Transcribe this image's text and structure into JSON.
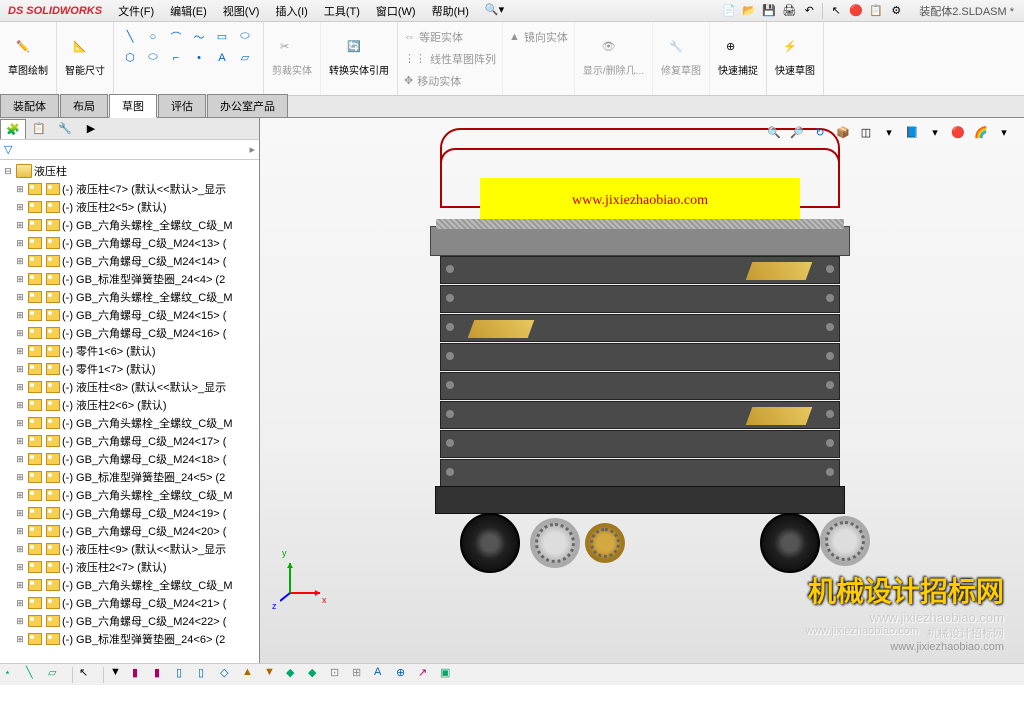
{
  "app": {
    "name": "SOLIDWORKS",
    "logo_prefix": "DS"
  },
  "document_title": "装配体2.SLDASM *",
  "menu": {
    "file": "文件(F)",
    "edit": "编辑(E)",
    "view": "视图(V)",
    "insert": "插入(I)",
    "tools": "工具(T)",
    "window": "窗口(W)",
    "help": "帮助(H)"
  },
  "ribbon": {
    "sketch": "草图绘制",
    "smart_dim": "智能尺寸",
    "trim": "剪裁实体",
    "convert": "转换实体引用",
    "offset": "等距实体",
    "mirror": "镜向实体",
    "linear_pattern": "线性草图阵列",
    "move": "移动实体",
    "display_delete": "显示/删除几...",
    "repair": "修复草图",
    "quick_snap": "快速捕捉",
    "rapid_sketch": "快速草图"
  },
  "tabs": {
    "assembly": "装配体",
    "layout": "布局",
    "sketch": "草图",
    "evaluate": "评估",
    "office": "办公室产品"
  },
  "tree": {
    "root": "液压柱",
    "items": [
      "(-) 液压柱<7>  (默认<<默认>_显示",
      "(-) 液压柱2<5>  (默认)",
      "(-) GB_六角头螺栓_全螺纹_C级_M",
      "(-) GB_六角螺母_C级_M24<13> (",
      "(-) GB_六角螺母_C级_M24<14> (",
      "(-) GB_标准型弹簧垫圈_24<4> (2",
      "(-) GB_六角头螺栓_全螺纹_C级_M",
      "(-) GB_六角螺母_C级_M24<15> (",
      "(-) GB_六角螺母_C级_M24<16> (",
      "(-) 零件1<6>  (默认)",
      "(-) 零件1<7>  (默认)",
      "(-) 液压柱<8>  (默认<<默认>_显示",
      "(-) 液压柱2<6>  (默认)",
      "(-) GB_六角头螺栓_全螺纹_C级_M",
      "(-) GB_六角螺母_C级_M24<17> (",
      "(-) GB_六角螺母_C级_M24<18> (",
      "(-) GB_标准型弹簧垫圈_24<5> (2",
      "(-) GB_六角头螺栓_全螺纹_C级_M",
      "(-) GB_六角螺母_C级_M24<19> (",
      "(-) GB_六角螺母_C级_M24<20> (",
      "(-) 液压柱<9>  (默认<<默认>_显示",
      "(-) 液压柱2<7>  (默认)",
      "(-) GB_六角头螺栓_全螺纹_C级_M",
      "(-) GB_六角螺母_C级_M24<21> (",
      "(-) GB_六角螺母_C级_M24<22> (",
      "(-) GB_标准型弹簧垫圈_24<6> (2"
    ]
  },
  "banner_url": "www.jixiezhaobiao.com",
  "watermark": {
    "title": "机械设计招标网",
    "url1": "www.jixiezhaobiao.com",
    "url2": "www.jixiezhaobiao.com",
    "sub": "机械设计招标网"
  },
  "triad": {
    "x": "x",
    "y": "y",
    "z": "z"
  },
  "filter_icon": "▽"
}
